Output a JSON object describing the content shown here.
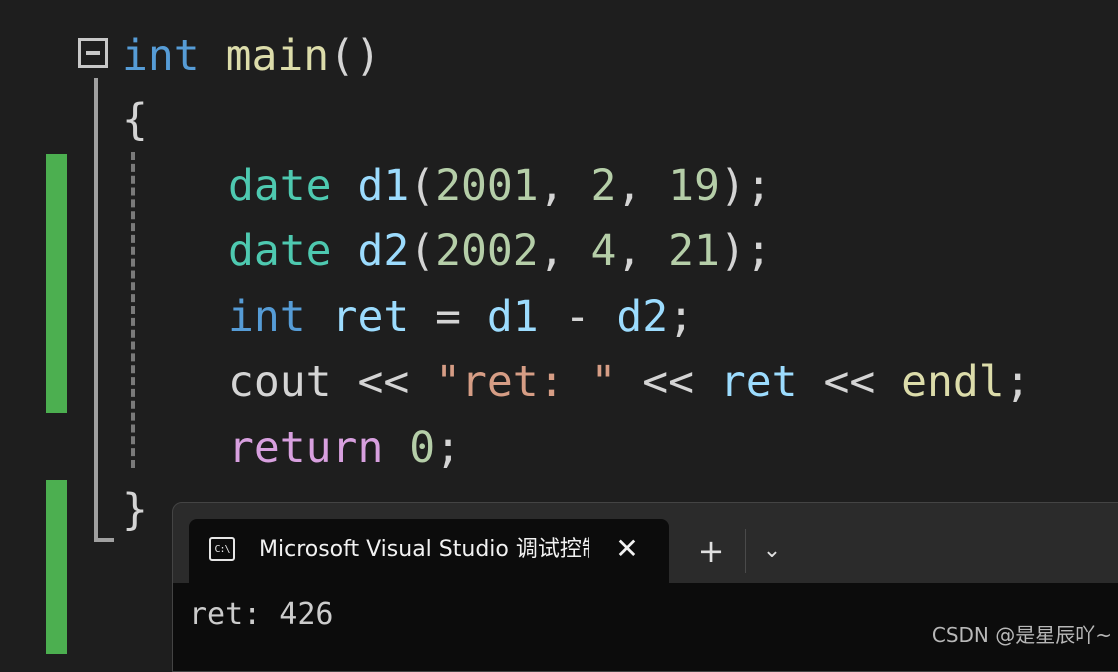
{
  "editor": {
    "lines": [
      {
        "tokens": [
          "int",
          " ",
          "main",
          "()"
        ]
      },
      {
        "tokens": [
          "{"
        ]
      },
      {
        "tokens": [
          "date",
          " ",
          "d1",
          "(",
          "2001",
          ", ",
          "2",
          ", ",
          "19",
          ");"
        ]
      },
      {
        "tokens": [
          "date",
          " ",
          "d2",
          "(",
          "2002",
          ", ",
          "4",
          ", ",
          "21",
          ");"
        ]
      },
      {
        "tokens": [
          "int",
          " ",
          "ret",
          " = ",
          "d1",
          " - ",
          "d2",
          ";"
        ]
      },
      {
        "tokens": [
          "cout",
          " << ",
          "\"ret: \"",
          " << ",
          "ret",
          " << ",
          "endl",
          ";"
        ]
      },
      {
        "tokens": [
          "return",
          " ",
          "0",
          ";"
        ]
      },
      {
        "tokens": [
          "}"
        ]
      }
    ],
    "fold_icon": "collapse-minus-icon",
    "colors": {
      "keyword": "#569cd6",
      "function": "#dcdcaa",
      "type": "#4ec9b0",
      "variable": "#9cdcfe",
      "number": "#b5cea8",
      "string": "#d69d85",
      "control": "#d8a0df",
      "change_bar": "#4caf50"
    }
  },
  "terminal": {
    "tab_icon": "console-icon",
    "tab_icon_text": "C:\\",
    "tab_title": "Microsoft Visual Studio 调试控制台",
    "close_label": "✕",
    "new_tab_label": "+",
    "dropdown_label": "⌄",
    "output": "ret: 426"
  },
  "watermark": "CSDN @是星辰吖~"
}
